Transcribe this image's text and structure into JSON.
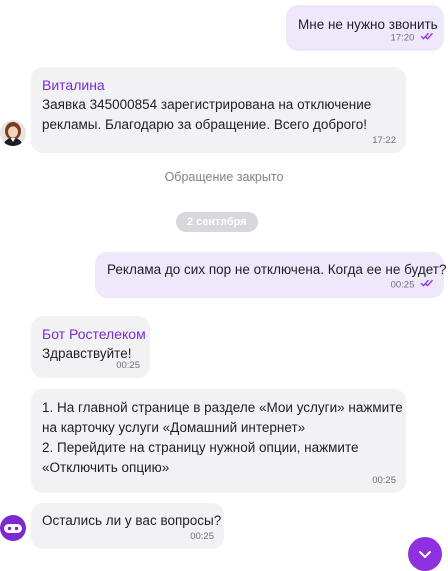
{
  "messages": {
    "m1": {
      "text": "Мне не нужно звонить",
      "time": "17:20"
    },
    "m2": {
      "sender": "Виталина",
      "line1": "Заявка 345000854 зарегистрирована на отключение",
      "line2": "рекламы. Благодарю за обращение. Всего доброго!",
      "time": "17:22"
    },
    "system": "Обращение закрыто",
    "date": "2 сентября",
    "m3": {
      "text": "Реклама до сих пор не отключена. Когда ее не будет?",
      "time": "00:25"
    },
    "m4": {
      "sender": "Бот Ростелеком",
      "text": "Здравствуйте!",
      "time": "00:25"
    },
    "m5": {
      "line1": "1. На главной странице в разделе «Мои услуги» нажмите",
      "line2": "на карточку услуги «Домашний интернет»",
      "line3": "2. Перейдите на страницу нужной опции, нажмите",
      "line4": "«Отключить опцию»",
      "time": "00:25"
    },
    "m6": {
      "text": "Остались ли у вас вопросы?",
      "time": "00:25"
    }
  },
  "icons": {
    "read_receipt": "double-check-icon",
    "scroll_down": "chevron-down-icon"
  },
  "colors": {
    "accent": "#8e2fe0",
    "sender_name": "#7a2bd1",
    "outgoing_bubble": "#efe8fb",
    "incoming_bubble": "#f2f2f4"
  }
}
